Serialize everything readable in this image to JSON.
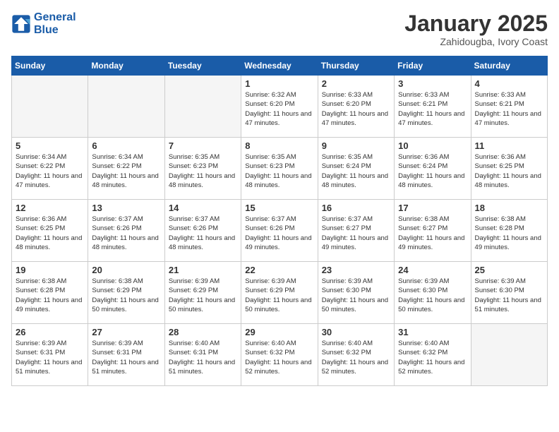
{
  "header": {
    "logo_line1": "General",
    "logo_line2": "Blue",
    "title": "January 2025",
    "subtitle": "Zahidougba, Ivory Coast"
  },
  "days_of_week": [
    "Sunday",
    "Monday",
    "Tuesday",
    "Wednesday",
    "Thursday",
    "Friday",
    "Saturday"
  ],
  "weeks": [
    [
      {
        "day": "",
        "info": ""
      },
      {
        "day": "",
        "info": ""
      },
      {
        "day": "",
        "info": ""
      },
      {
        "day": "1",
        "info": "Sunrise: 6:32 AM\nSunset: 6:20 PM\nDaylight: 11 hours\nand 47 minutes."
      },
      {
        "day": "2",
        "info": "Sunrise: 6:33 AM\nSunset: 6:20 PM\nDaylight: 11 hours\nand 47 minutes."
      },
      {
        "day": "3",
        "info": "Sunrise: 6:33 AM\nSunset: 6:21 PM\nDaylight: 11 hours\nand 47 minutes."
      },
      {
        "day": "4",
        "info": "Sunrise: 6:33 AM\nSunset: 6:21 PM\nDaylight: 11 hours\nand 47 minutes."
      }
    ],
    [
      {
        "day": "5",
        "info": "Sunrise: 6:34 AM\nSunset: 6:22 PM\nDaylight: 11 hours\nand 47 minutes."
      },
      {
        "day": "6",
        "info": "Sunrise: 6:34 AM\nSunset: 6:22 PM\nDaylight: 11 hours\nand 48 minutes."
      },
      {
        "day": "7",
        "info": "Sunrise: 6:35 AM\nSunset: 6:23 PM\nDaylight: 11 hours\nand 48 minutes."
      },
      {
        "day": "8",
        "info": "Sunrise: 6:35 AM\nSunset: 6:23 PM\nDaylight: 11 hours\nand 48 minutes."
      },
      {
        "day": "9",
        "info": "Sunrise: 6:35 AM\nSunset: 6:24 PM\nDaylight: 11 hours\nand 48 minutes."
      },
      {
        "day": "10",
        "info": "Sunrise: 6:36 AM\nSunset: 6:24 PM\nDaylight: 11 hours\nand 48 minutes."
      },
      {
        "day": "11",
        "info": "Sunrise: 6:36 AM\nSunset: 6:25 PM\nDaylight: 11 hours\nand 48 minutes."
      }
    ],
    [
      {
        "day": "12",
        "info": "Sunrise: 6:36 AM\nSunset: 6:25 PM\nDaylight: 11 hours\nand 48 minutes."
      },
      {
        "day": "13",
        "info": "Sunrise: 6:37 AM\nSunset: 6:26 PM\nDaylight: 11 hours\nand 48 minutes."
      },
      {
        "day": "14",
        "info": "Sunrise: 6:37 AM\nSunset: 6:26 PM\nDaylight: 11 hours\nand 48 minutes."
      },
      {
        "day": "15",
        "info": "Sunrise: 6:37 AM\nSunset: 6:26 PM\nDaylight: 11 hours\nand 49 minutes."
      },
      {
        "day": "16",
        "info": "Sunrise: 6:37 AM\nSunset: 6:27 PM\nDaylight: 11 hours\nand 49 minutes."
      },
      {
        "day": "17",
        "info": "Sunrise: 6:38 AM\nSunset: 6:27 PM\nDaylight: 11 hours\nand 49 minutes."
      },
      {
        "day": "18",
        "info": "Sunrise: 6:38 AM\nSunset: 6:28 PM\nDaylight: 11 hours\nand 49 minutes."
      }
    ],
    [
      {
        "day": "19",
        "info": "Sunrise: 6:38 AM\nSunset: 6:28 PM\nDaylight: 11 hours\nand 49 minutes."
      },
      {
        "day": "20",
        "info": "Sunrise: 6:38 AM\nSunset: 6:29 PM\nDaylight: 11 hours\nand 50 minutes."
      },
      {
        "day": "21",
        "info": "Sunrise: 6:39 AM\nSunset: 6:29 PM\nDaylight: 11 hours\nand 50 minutes."
      },
      {
        "day": "22",
        "info": "Sunrise: 6:39 AM\nSunset: 6:29 PM\nDaylight: 11 hours\nand 50 minutes."
      },
      {
        "day": "23",
        "info": "Sunrise: 6:39 AM\nSunset: 6:30 PM\nDaylight: 11 hours\nand 50 minutes."
      },
      {
        "day": "24",
        "info": "Sunrise: 6:39 AM\nSunset: 6:30 PM\nDaylight: 11 hours\nand 50 minutes."
      },
      {
        "day": "25",
        "info": "Sunrise: 6:39 AM\nSunset: 6:30 PM\nDaylight: 11 hours\nand 51 minutes."
      }
    ],
    [
      {
        "day": "26",
        "info": "Sunrise: 6:39 AM\nSunset: 6:31 PM\nDaylight: 11 hours\nand 51 minutes."
      },
      {
        "day": "27",
        "info": "Sunrise: 6:39 AM\nSunset: 6:31 PM\nDaylight: 11 hours\nand 51 minutes."
      },
      {
        "day": "28",
        "info": "Sunrise: 6:40 AM\nSunset: 6:31 PM\nDaylight: 11 hours\nand 51 minutes."
      },
      {
        "day": "29",
        "info": "Sunrise: 6:40 AM\nSunset: 6:32 PM\nDaylight: 11 hours\nand 52 minutes."
      },
      {
        "day": "30",
        "info": "Sunrise: 6:40 AM\nSunset: 6:32 PM\nDaylight: 11 hours\nand 52 minutes."
      },
      {
        "day": "31",
        "info": "Sunrise: 6:40 AM\nSunset: 6:32 PM\nDaylight: 11 hours\nand 52 minutes."
      },
      {
        "day": "",
        "info": ""
      }
    ]
  ]
}
